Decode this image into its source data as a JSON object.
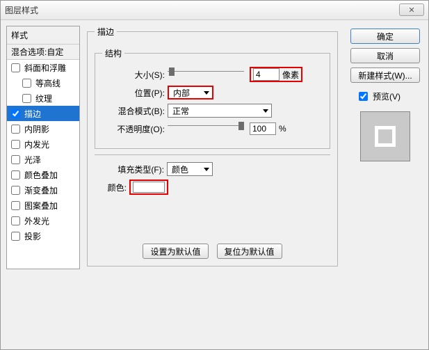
{
  "title": "图层样式",
  "close_label": "✕",
  "sidebar": {
    "header": "样式",
    "blend_options": "混合选项:自定",
    "items": [
      {
        "label": "斜面和浮雕",
        "checked": false
      },
      {
        "label": "等高线",
        "checked": false,
        "indent": true
      },
      {
        "label": "纹理",
        "checked": false,
        "indent": true
      },
      {
        "label": "描边",
        "checked": true,
        "selected": true
      },
      {
        "label": "内阴影",
        "checked": false
      },
      {
        "label": "内发光",
        "checked": false
      },
      {
        "label": "光泽",
        "checked": false
      },
      {
        "label": "颜色叠加",
        "checked": false
      },
      {
        "label": "渐变叠加",
        "checked": false
      },
      {
        "label": "图案叠加",
        "checked": false
      },
      {
        "label": "外发光",
        "checked": false
      },
      {
        "label": "投影",
        "checked": false
      }
    ]
  },
  "stroke": {
    "panel_title": "描边",
    "structure_title": "结构",
    "size_label": "大小(S):",
    "size_value": "4",
    "size_unit": "像素",
    "position_label": "位置(P):",
    "position_value": "内部",
    "blendmode_label": "混合模式(B):",
    "blendmode_value": "正常",
    "opacity_label": "不透明度(O):",
    "opacity_value": "100",
    "opacity_unit": "%",
    "filltype_label": "填充类型(F):",
    "filltype_value": "颜色",
    "color_label": "颜色:",
    "set_default": "设置为默认值",
    "reset_default": "复位为默认值"
  },
  "buttons": {
    "ok": "确定",
    "cancel": "取消",
    "new_style": "新建样式(W)...",
    "preview": "预览(V)"
  }
}
